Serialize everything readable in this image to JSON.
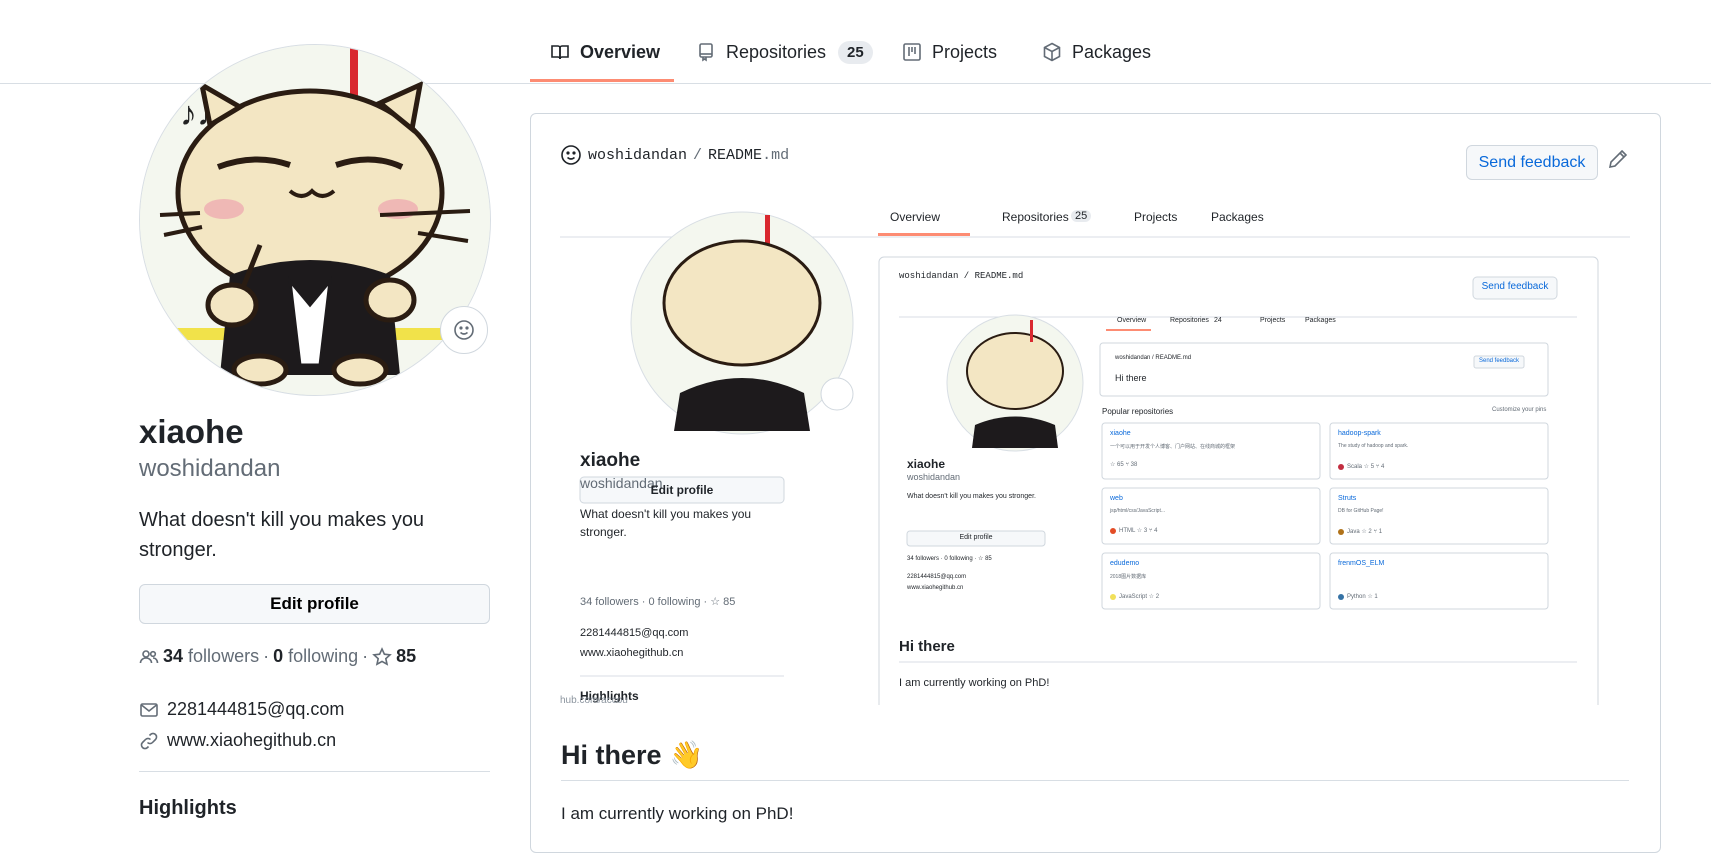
{
  "nav": {
    "tabs": [
      {
        "label": "Overview",
        "icon": "book-icon",
        "selected": true
      },
      {
        "label": "Repositories",
        "icon": "repo-icon",
        "count": "25"
      },
      {
        "label": "Projects",
        "icon": "project-icon"
      },
      {
        "label": "Packages",
        "icon": "package-icon"
      }
    ]
  },
  "profile": {
    "name": "xiaohe",
    "login": "woshidandan",
    "bio": "What doesn't kill you makes you stronger.",
    "edit_label": "Edit profile",
    "followers_count": "34",
    "followers_label": "followers",
    "following_count": "0",
    "following_label": "following",
    "stars": "85",
    "email": "2281444815@qq.com",
    "website": "www.xiaohegithub.cn",
    "highlights": "Highlights"
  },
  "readme": {
    "owner": "woshidandan",
    "separator": "/",
    "file": "README",
    "ext": ".md",
    "send_feedback": "Send feedback",
    "heading": "Hi there",
    "wave": "👋",
    "paragraph": "I am currently working on PhD!"
  },
  "inner1": {
    "tabs": [
      "Overview",
      "Repositories",
      "Projects",
      "Packages"
    ],
    "repo_count": "25",
    "head": "woshidandan / README.md",
    "send_feedback": "Send feedback",
    "name": "xiaohe",
    "login": "woshidandan",
    "bio": "What doesn't kill you makes you stronger.",
    "edit_label": "Edit profile",
    "followers": "34 followers · 0 following · ☆ 85",
    "email": "2281444815@qq.com",
    "website": "www.xiaohegithub.cn",
    "highlights": "Highlights",
    "url_fragment": "hub.com/accou",
    "heading": "Hi there",
    "paragraph": "I am currently working on PhD!"
  },
  "inner2": {
    "tabs": [
      "Overview",
      "Repositories",
      "Projects",
      "Packages"
    ],
    "repo_count": "24",
    "head": "woshidandan / README.md",
    "send_feedback": "Send feedback",
    "hi": "Hi there",
    "popular": "Popular repositories",
    "customize": "Customize your pins",
    "name": "xiaohe",
    "login": "woshidandan",
    "bio": "What doesn't kill you makes you stronger.",
    "edit_label": "Edit profile",
    "followers": "34 followers · 0 following · ☆ 85",
    "email": "2281444815@qq.com",
    "website": "www.xiaohegithub.cn",
    "repos": [
      {
        "name": "xiaohe",
        "desc": "一个可以用于开发个人博客、门户网站、在线商城的框架",
        "lang": "",
        "stars": "65",
        "forks": "38"
      },
      {
        "name": "hadoop-spark",
        "desc": "The study of hadoop and spark.",
        "lang": "Scala",
        "stars": "5",
        "forks": "4"
      },
      {
        "name": "web",
        "desc": "jsp/html/css/JavaScript...",
        "lang": "HTML",
        "stars": "3",
        "forks": "4"
      },
      {
        "name": "Struts",
        "desc": "DB for GitHub Page!",
        "lang": "Java",
        "stars": "2",
        "forks": "1"
      },
      {
        "name": "edudemo",
        "desc": "2018图片数据库",
        "lang": "JavaScript",
        "stars": "2",
        "forks": ""
      },
      {
        "name": "frenmOS_ELM",
        "desc": "",
        "lang": "Python",
        "stars": "1",
        "forks": ""
      }
    ]
  },
  "colors": {
    "tab_underline": "#fd8c73",
    "link": "#0969da",
    "muted": "#636c76",
    "border": "#d0d7de",
    "lang_scala": "#c22d40",
    "lang_html": "#e34c26",
    "lang_java": "#b07219",
    "lang_js": "#f1e05a",
    "lang_python": "#3572A5"
  }
}
